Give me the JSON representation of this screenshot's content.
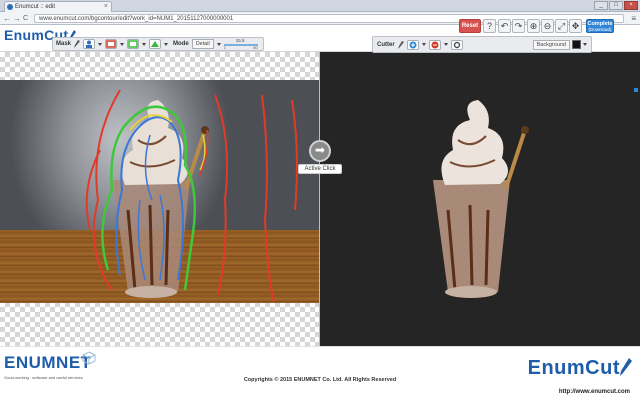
{
  "browser": {
    "tab_title": "Enumcut :: edit",
    "tab_close": "×",
    "url": "www.enumcut.com/bgcontour/edit?work_id=NUM1_20151127000000001",
    "back": "←",
    "forward": "→",
    "reload": "C",
    "menu": "≡",
    "win_min": "_",
    "win_max": "□",
    "win_close": "×"
  },
  "app": {
    "logo_prefix": "Enum",
    "logo_suffix": "Cut",
    "mask_toolbar": {
      "label": "Mask",
      "mode_label": "Mode",
      "mode_value": "Detail",
      "slider_value": "15.5",
      "slider_min": "1",
      "slider_max": "50"
    },
    "cutter_toolbar": {
      "label": "Cutter",
      "background_label": "Background",
      "background_color": "#111111"
    },
    "actions": {
      "reset": "Reset",
      "help": "?",
      "undo": "↶",
      "redo": "↷",
      "zoom_in": "⊕",
      "zoom_out": "⊖",
      "fit": "⤢",
      "move": "✥",
      "complete": "Complete",
      "complete_sub": "(Download)"
    },
    "active_click": {
      "icon": "➡",
      "label": "Active Click"
    }
  },
  "footer": {
    "left_logo": "ENUMNET",
    "left_slogan": "Good-working : software and useful services",
    "copyright": "Copyrights © 2015 ENUMNET Co. Ltd. All Rights Reserved",
    "right_logo_prefix": "Enum",
    "right_logo_suffix": "Cut",
    "right_url": "http://www.enumcut.com"
  },
  "colors": {
    "brand_blue": "#1f5da8",
    "reset_red": "#d8534f",
    "complete_blue": "#2f85d6",
    "mask_red": "#e23a2a",
    "mask_green": "#3ec83a",
    "mask_blue": "#3a78d8",
    "mask_yellow": "#e8d23a"
  }
}
